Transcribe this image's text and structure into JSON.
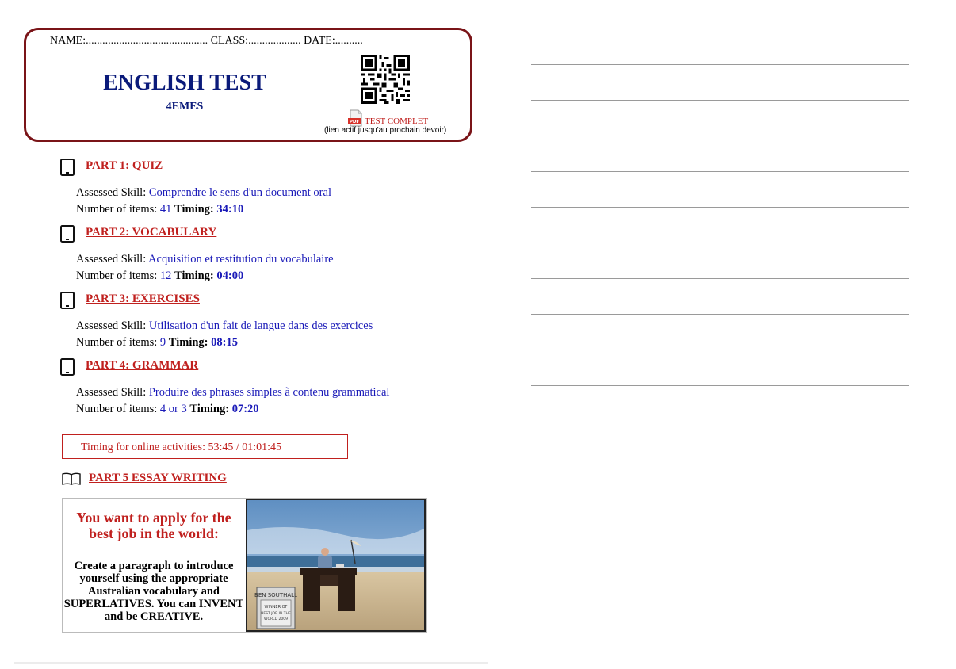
{
  "header": {
    "name_line": "NAME:............................................ CLASS:................... DATE:..........",
    "title": "ENGLISH TEST",
    "subtitle": "4EMES",
    "pdf_icon_label": "PDF",
    "pdf_link": "TEST COMPLET",
    "pdf_note": "(lien actif jusqu'au prochain devoir)"
  },
  "parts": [
    {
      "title": "PART 1: QUIZ",
      "skill_label": "Assessed Skill: ",
      "skill": "Comprendre le sens d'un document oral",
      "items_label": "Number of items: ",
      "items": "41",
      "timing_label": "Timing: ",
      "timing": "34:10"
    },
    {
      "title": "PART 2: VOCABULARY",
      "skill_label": "Assessed Skill: ",
      "skill": "Acquisition et restitution du vocabulaire",
      "items_label": "Number of items: ",
      "items": "12",
      "timing_label": "Timing: ",
      "timing": "04:00"
    },
    {
      "title": "PART 3: EXERCISES",
      "skill_label": "Assessed Skill: ",
      "skill": "Utilisation d'un fait de langue dans des exercices",
      "items_label": "Number of items: ",
      "items": "9",
      "timing_label": "Timing: ",
      "timing": "08:15"
    },
    {
      "title": "PART 4: GRAMMAR",
      "skill_label": "Assessed Skill: ",
      "skill": "Produire des phrases simples à contenu grammatical",
      "items_label": "Number of items: ",
      "items": "4 or 3",
      "timing_label": "Timing: ",
      "timing": "07:20"
    }
  ],
  "timing_summary": "Timing for online activities: 53:45 / 01:01:45",
  "part5": {
    "title": "PART 5 ESSAY WRITING",
    "headline": "You want to apply for the best job in the world:",
    "instructions": "Create a paragraph to introduce yourself using the appropriate Australian vocabulary and SUPERLATIVES. You can INVENT and be CREATIVE.",
    "photo_sign_name": "BEN SOUTHALL",
    "photo_sign_line1": "WINNER OF",
    "photo_sign_line2": "BEST JOB IN THE",
    "photo_sign_line3": "WORLD 2009"
  },
  "icons": {
    "part_icon": "tablet-icon",
    "part5_icon": "open-book-icon",
    "qr": "qr-code-icon",
    "pdf": "pdf-file-icon"
  },
  "colors": {
    "header_border": "#7a1418",
    "title": "#0a1a7a",
    "part_title": "#c0201e",
    "value_blue": "#1a1ab8"
  }
}
